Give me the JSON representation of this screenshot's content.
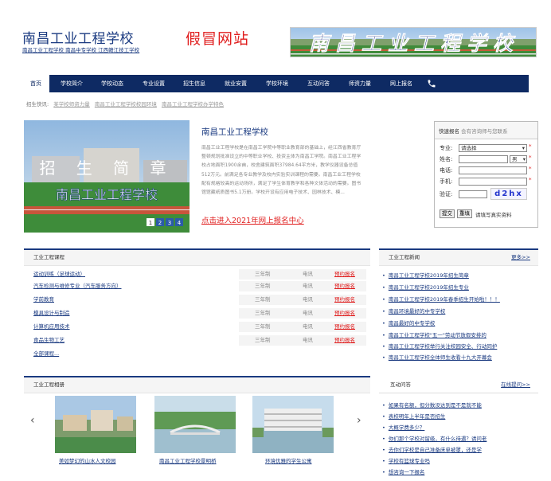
{
  "header": {
    "title": "南昌工业工程学校",
    "subtitle": "南昌工业工程学校 南昌中专学校 江西赣江技工学校",
    "fake_label": "假冒网站",
    "banner_text": "南昌工业工程学校"
  },
  "nav": {
    "items": [
      "首页",
      "学校简介",
      "学校动态",
      "专业设置",
      "招生信息",
      "就业安置",
      "学校环境",
      "互动问答",
      "师资力量",
      "网上报名"
    ],
    "phone_icon": "phone-icon"
  },
  "quick": {
    "label": "招生快讯:",
    "links": [
      "某学校师资力量",
      "南昌工业工程学校校园环境",
      "南昌工业工程学校办学特色"
    ]
  },
  "intro": {
    "photo_caption_top": "招 生 简 章",
    "photo_caption_bottom": "南昌工业工程学校",
    "pager": [
      "1",
      "2",
      "3",
      "4"
    ],
    "title": "南昌工业工程学校",
    "text": "南昌工业工程学校是在南昌工学院中等职业教育部的基础上，经江西省教育厅整顿规划批准设立的中等职业学校、投资主体为南昌工学院。南昌工业工程学校占地面积1900余亩，校舍建筑面积37984.64平方米，教学仪器设备总值512万元。前满足各专业教学及校内实验实训课程的需要。南昌工业工程学校配有规格较高的运动场所，满足了学生体育教学和各种文体活动的需要。图书馆馆藏纸质图书5.1万册。学校开设有应用电子技术、园林技术、模...",
    "link": "点击进入2021年网上报名中心"
  },
  "signup": {
    "title": "快速报名",
    "title_hint": "会有咨询师与您联系",
    "major_label": "专业:",
    "major_value": "请选择",
    "name_label": "姓名:",
    "gender_value": "男",
    "phone_label": "电话:",
    "mobile_label": "手机:",
    "captcha_label": "验证:",
    "captcha_value": "d2hx",
    "submit_label": "提交",
    "reset_label": "重填",
    "note": "请填写真实资料"
  },
  "course": {
    "title": "工业工程课程",
    "rows": [
      {
        "name": "运动训练（足球运动）",
        "years": "三年制",
        "type": "电讯",
        "action": "预约报名"
      },
      {
        "name": "汽车检测与维修专业（汽车服务方向）",
        "years": "三年制",
        "type": "电讯",
        "action": "预约报名"
      },
      {
        "name": "学前教育",
        "years": "三年制",
        "type": "电讯",
        "action": "预约报名"
      },
      {
        "name": "模具设计与制造",
        "years": "三年制",
        "type": "电讯",
        "action": "预约报名"
      },
      {
        "name": "计算机应用技术",
        "years": "三年制",
        "type": "电讯",
        "action": "预约报名"
      },
      {
        "name": "食品生物工艺",
        "years": "三年制",
        "type": "电讯",
        "action": "预约报名"
      }
    ],
    "all_link": "全部课程..."
  },
  "news": {
    "title": "工业工程新闻",
    "more": "更多>>",
    "items": [
      "南昌工业工程学校2019年招生简章",
      "南昌工业工程学校2019年招生专业",
      "南昌工业工程学校2019年春季招生开始啦！！！",
      "南昌环境最好的中专学校",
      "南昌最好的中专学校",
      "南昌工业工程学校\"五一\"劳动节放假安排的",
      "南昌工业工程学校举行关注校园安全、行动同护",
      "南昌工业工程学校全体师生收看十九大开幕会"
    ]
  },
  "album": {
    "title": "工业工程相册",
    "items": [
      "美如梦幻的山水人文校园",
      "南昌工业工程学校景明桥",
      "环境优雅的学生公寓"
    ],
    "prev": "‹",
    "next": "›"
  },
  "qa": {
    "title": "互动问答",
    "more": "在线提问>>",
    "items": [
      "如果有名额，但分数没达到是不是就不能",
      "表校明年上半年是否招生",
      "大概学费多少？",
      "你们那个学校对留级，有什么待遇？请问老",
      "去你们学校是自己准备床单被罩，还是学",
      "学校有篮球专业吗",
      "想咨询一下报名"
    ]
  }
}
